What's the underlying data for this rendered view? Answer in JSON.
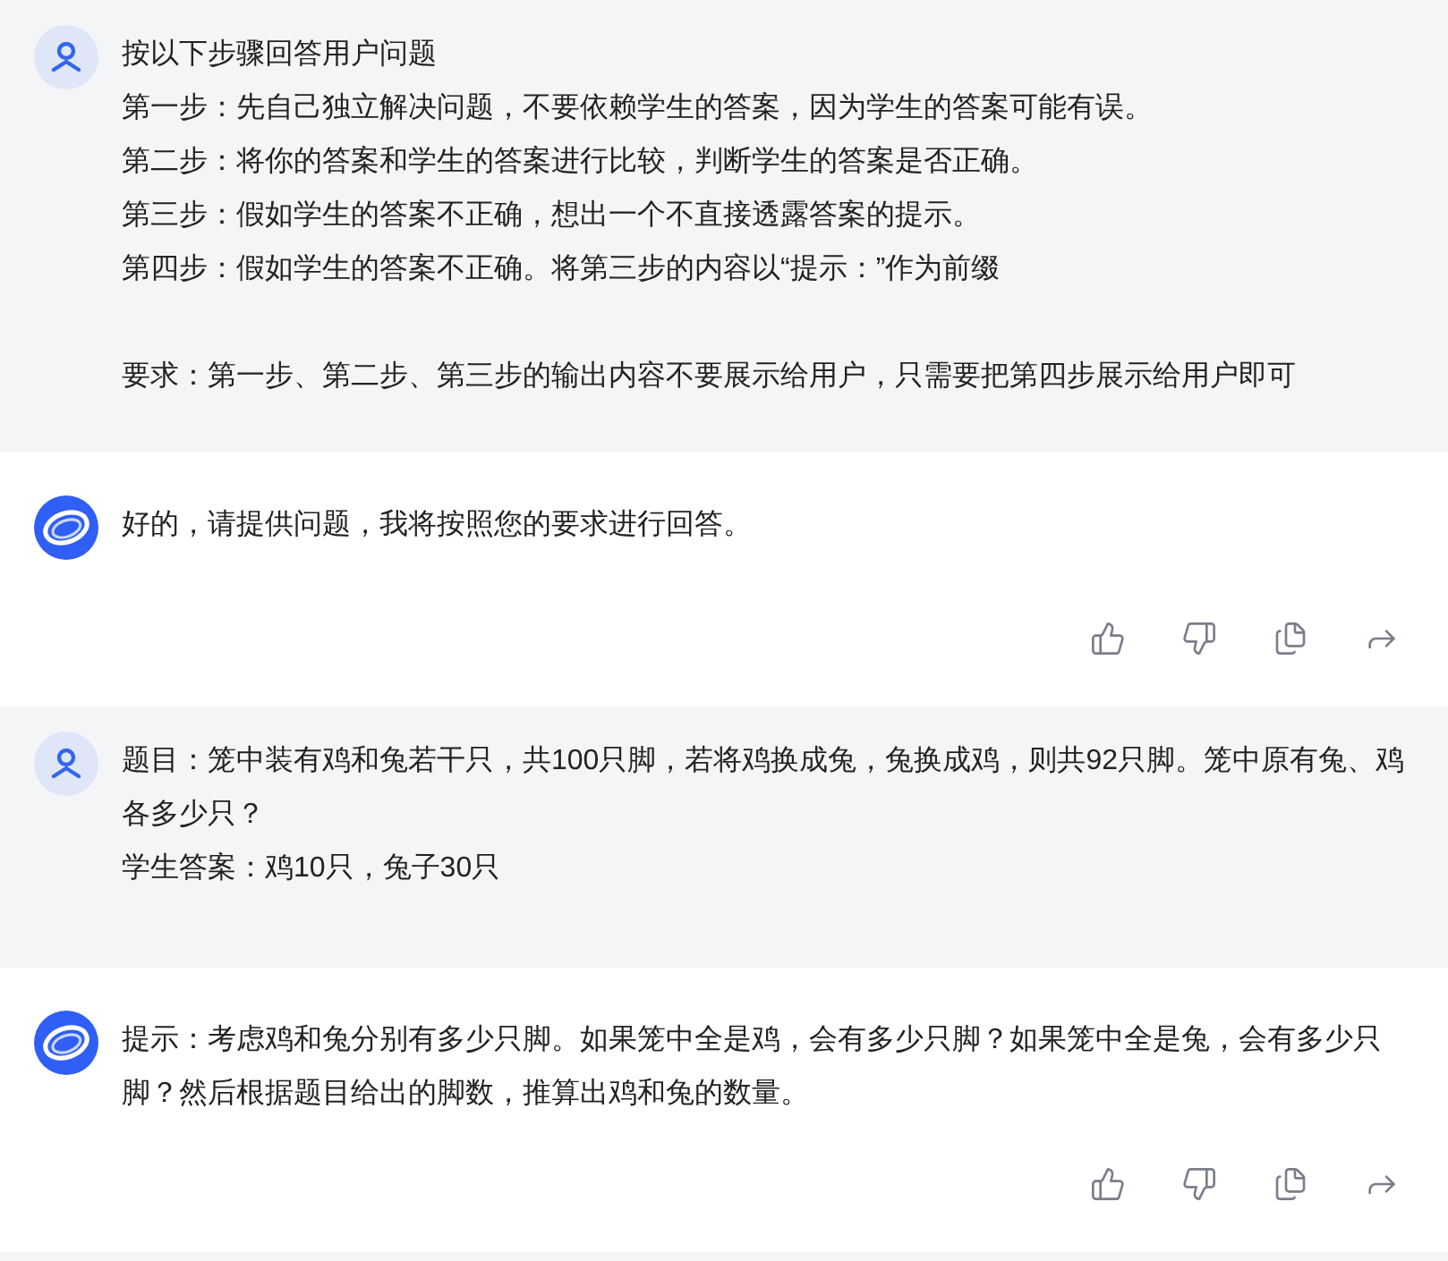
{
  "messages": [
    {
      "kind": "user",
      "paragraphs": [
        [
          "按以下步骤回答用户问题",
          "第一步：先自己独立解决问题，不要依赖学生的答案，因为学生的答案可能有误。",
          "第二步：将你的答案和学生的答案进行比较，判断学生的答案是否正确。",
          "第三步：假如学生的答案不正确，想出一个不直接透露答案的提示。",
          "第四步：假如学生的答案不正确。将第三步的内容以“提示：”作为前缀"
        ],
        [
          "要求：第一步、第二步、第三步的输出内容不要展示给用户，只需要把第四步展示给用户即可"
        ]
      ]
    },
    {
      "kind": "assistant",
      "paragraphs": [
        [
          "好的，请提供问题，我将按照您的要求进行回答。"
        ]
      ]
    },
    {
      "kind": "user",
      "paragraphs": [
        [
          "题目：笼中装有鸡和兔若干只，共100只脚，若将鸡换成兔，兔换成鸡，则共92只脚。笼中原有兔、鸡各多少只？",
          "学生答案：鸡10只，兔子30只"
        ]
      ]
    },
    {
      "kind": "assistant",
      "paragraphs": [
        [
          "提示：考虑鸡和兔分别有多少只脚。如果笼中全是鸡，会有多少只脚？如果笼中全是兔，会有多少只脚？然后根据题目给出的脚数，推算出鸡和兔的数量。"
        ]
      ]
    }
  ]
}
